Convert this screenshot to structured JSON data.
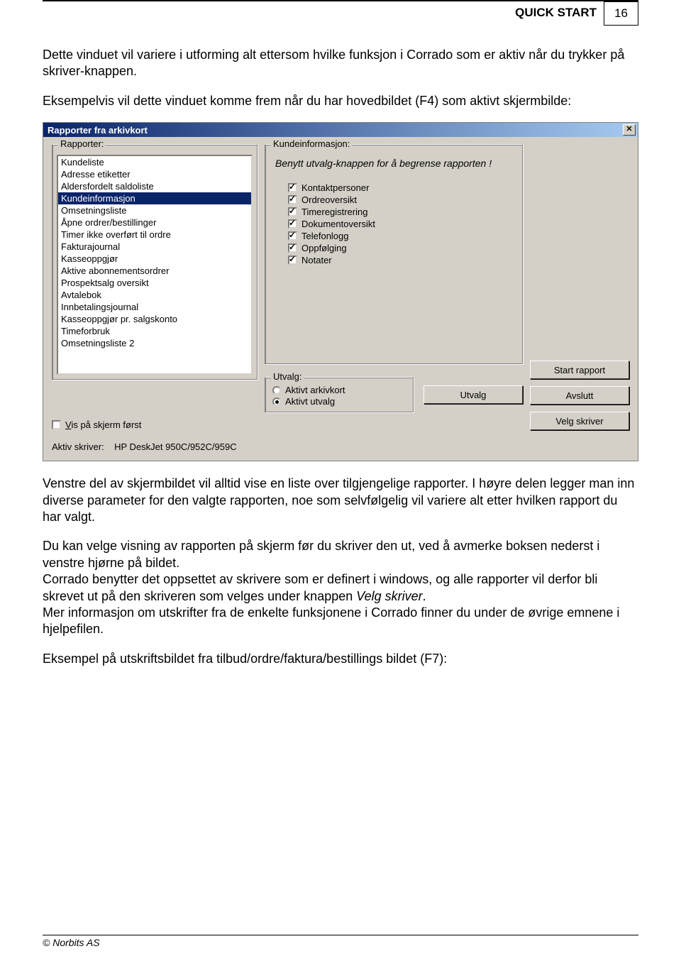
{
  "header": {
    "section": "QUICK START",
    "page": "16"
  },
  "paragraphs": {
    "p1": "Dette vinduet vil variere i utforming alt ettersom hvilke funksjon i Corrado som er aktiv når du trykker på skriver-knappen.",
    "p2": "Eksempelvis vil dette vinduet komme frem når du har hovedbildet (F4) som aktivt skjermbilde:",
    "p3": "Venstre del av skjermbildet vil alltid vise en liste over tilgjengelige rapporter. I høyre delen legger man inn diverse parameter for den valgte rapporten, noe som selvfølgelig vil variere alt etter hvilken rapport du har valgt.",
    "p4a": "Du kan velge visning av rapporten på skjerm før du skriver den ut, ved å avmerke boksen nederst i venstre hjørne på bildet.",
    "p4b_pre": "Corrado benytter det oppsettet av skrivere som er definert i windows, og alle rapporter vil derfor bli skrevet ut på den skriveren som velges under knappen ",
    "p4b_em": "Velg skriver",
    "p4b_post": ".",
    "p4c": "Mer informasjon om utskrifter fra de enkelte funksjonene i Corrado finner du under de øvrige emnene i hjelpefilen.",
    "p5": "Eksempel på utskriftsbildet fra tilbud/ordre/faktura/bestillings bildet (F7):"
  },
  "dialog": {
    "title": "Rapporter fra arkivkort",
    "rapporter_legend": "Rapporter:",
    "rapporter_items": [
      "Kundeliste",
      "Adresse etiketter",
      "Aldersfordelt saldoliste",
      "Kundeinformasjon",
      "Omsetningsliste",
      "Åpne ordrer/bestillinger",
      "Timer ikke overført til ordre",
      "Fakturajournal",
      "Kasseoppgjør",
      "Aktive abonnementsordrer",
      "Prospektsalg oversikt",
      "Avtalebok",
      "Innbetalingsjournal",
      "Kasseoppgjør pr. salgskonto",
      "Timeforbruk",
      "Omsetningsliste 2"
    ],
    "rapporter_selected_index": 3,
    "kunde_legend": "Kundeinformasjon:",
    "hint": "Benytt utvalg-knappen for å begrense rapporten !",
    "checks": [
      "Kontaktpersoner",
      "Ordreoversikt",
      "Timeregistrering",
      "Dokumentoversikt",
      "Telefonlogg",
      "Oppfølging",
      "Notater"
    ],
    "utvalg_legend": "Utvalg:",
    "radio1": "Aktivt arkivkort",
    "radio2": "Aktivt utvalg",
    "btn_utvalg": "Utvalg",
    "btn_start": "Start rapport",
    "btn_avslutt": "Avslutt",
    "btn_velg": "Velg skriver",
    "vis_check_first": "V",
    "vis_check_rest": "is på skjerm først",
    "printer_label": "Aktiv skriver:",
    "printer_value": "HP DeskJet 950C/952C/959C"
  },
  "footer": "© Norbits AS"
}
